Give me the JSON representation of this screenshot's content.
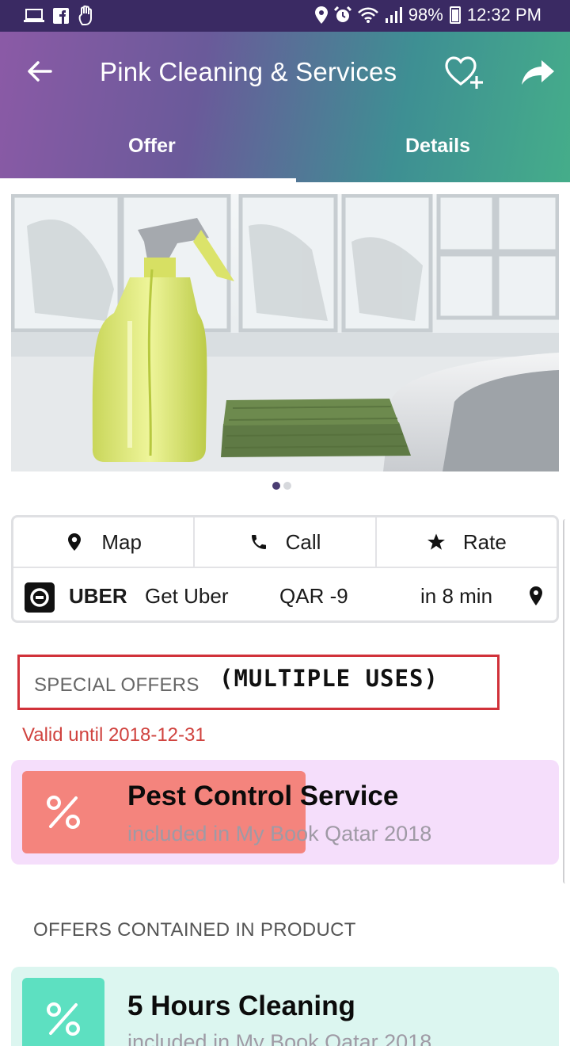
{
  "status_bar": {
    "battery": "98%",
    "time": "12:32 PM",
    "left_icons": [
      "laptop-icon",
      "facebook-icon",
      "hand-icon"
    ],
    "right_icons": [
      "location-icon",
      "alarm-icon",
      "wifi-icon",
      "signal-icon",
      "battery-icon"
    ]
  },
  "header": {
    "title": "Pink Cleaning & Services",
    "tabs": [
      {
        "label": "Offer",
        "active": true
      },
      {
        "label": "Details",
        "active": false
      }
    ],
    "gradient": [
      "#8b5aa6",
      "#45ad8a"
    ]
  },
  "carousel": {
    "pages": 2,
    "current": 1
  },
  "actions": {
    "items": [
      {
        "label": "Map",
        "icon": "map-pin-icon"
      },
      {
        "label": "Call",
        "icon": "phone-icon"
      },
      {
        "label": "Rate",
        "icon": "star-icon"
      }
    ],
    "uber": {
      "brand": "UBER",
      "cta": "Get Uber",
      "price": "QAR -9",
      "eta": "in 8 min"
    }
  },
  "special_offers": {
    "heading": "SPECIAL OFFERS",
    "note": "(MULTIPLE USES)",
    "valid_until": "Valid until 2018-12-31",
    "offer": {
      "title": "Pest Control Service",
      "subtitle": "included in My Book Qatar 2018",
      "accent": "#f4847d"
    }
  },
  "product_offers": {
    "heading": "OFFERS CONTAINED IN PRODUCT",
    "offer": {
      "title": "5 Hours Cleaning",
      "subtitle": "included in My Book Qatar 2018",
      "accent": "#5de0c1"
    }
  }
}
